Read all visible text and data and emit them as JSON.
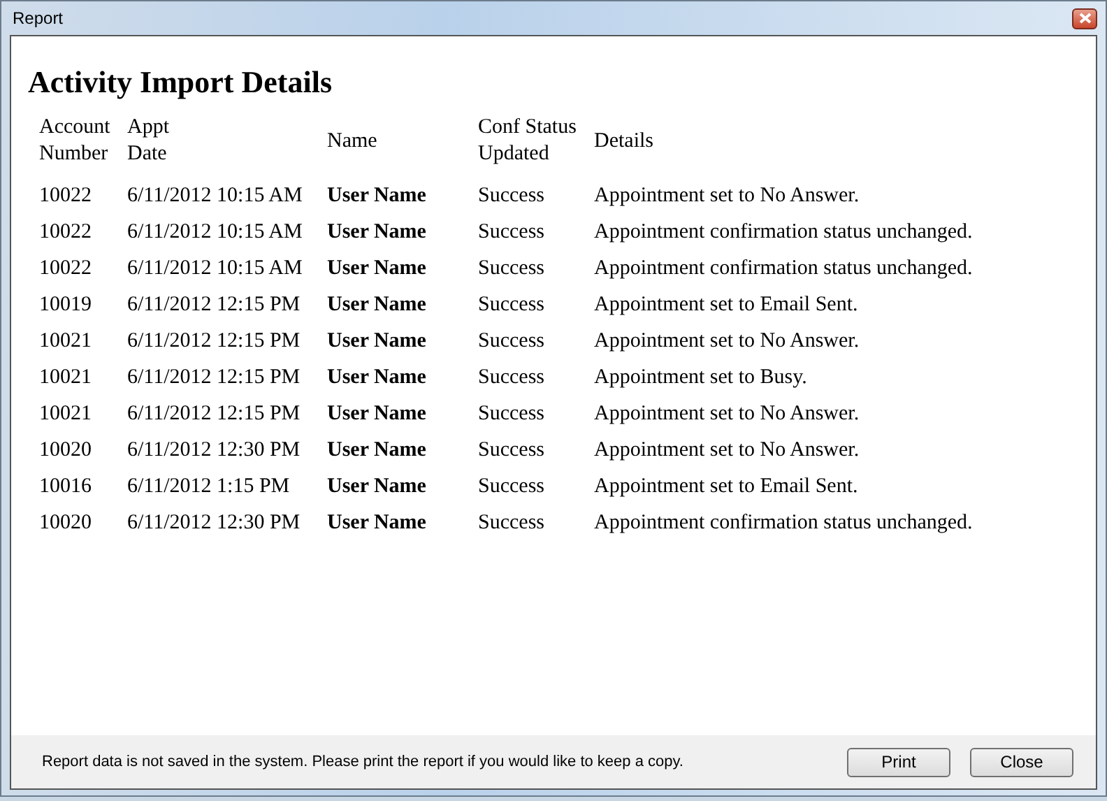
{
  "window": {
    "title": "Report"
  },
  "heading": "Activity Import Details",
  "table": {
    "columns": [
      "Account Number",
      "Appt Date",
      "Name",
      "Conf Status Updated",
      "Details"
    ],
    "rows": [
      [
        "10022",
        "6/11/2012 10:15 AM",
        "User Name",
        "Success",
        "Appointment set to No Answer."
      ],
      [
        "10022",
        "6/11/2012 10:15 AM",
        "User Name",
        "Success",
        "Appointment confirmation status unchanged."
      ],
      [
        "10022",
        "6/11/2012 10:15 AM",
        "User Name",
        "Success",
        "Appointment confirmation status unchanged."
      ],
      [
        "10019",
        "6/11/2012 12:15 PM",
        "User Name",
        "Success",
        "Appointment set to Email Sent."
      ],
      [
        "10021",
        "6/11/2012 12:15 PM",
        "User Name",
        "Success",
        "Appointment set to No Answer."
      ],
      [
        "10021",
        "6/11/2012 12:15 PM",
        "User Name",
        "Success",
        "Appointment set to Busy."
      ],
      [
        "10021",
        "6/11/2012 12:15 PM",
        "User Name",
        "Success",
        "Appointment set to No Answer."
      ],
      [
        "10020",
        "6/11/2012 12:30 PM",
        "User Name",
        "Success",
        "Appointment set to No Answer."
      ],
      [
        "10016",
        "6/11/2012 1:15 PM",
        "User Name",
        "Success",
        "Appointment set to Email Sent."
      ],
      [
        "10020",
        "6/11/2012 12:30 PM",
        "User Name",
        "Success",
        "Appointment confirmation status unchanged."
      ]
    ]
  },
  "status_bar": {
    "message": "Report data is not saved in the system. Please print the report if you would like to keep a copy.",
    "buttons": [
      "Print",
      "Close"
    ]
  }
}
